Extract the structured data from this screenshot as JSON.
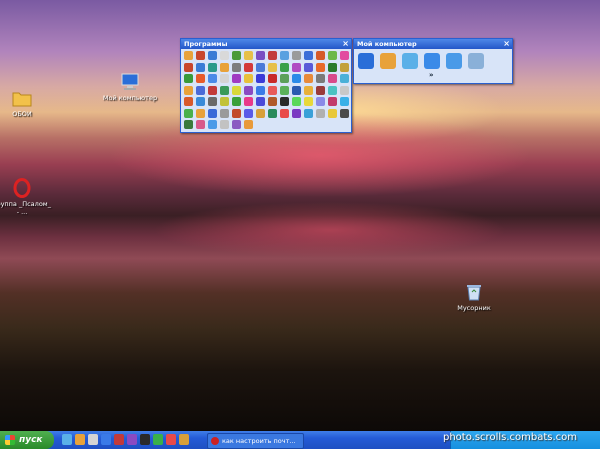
{
  "desktop": {
    "icons": [
      {
        "label": "ОБОИ",
        "icon": "folder-icon"
      },
      {
        "label": "Мой компьютер",
        "icon": "my-computer-icon"
      },
      {
        "label": "группа _Псалом_ - ...",
        "icon": "opera-icon"
      },
      {
        "label": "Мусорник",
        "icon": "recycle-bin-icon"
      }
    ]
  },
  "programs_toolbar": {
    "title": "Программы",
    "close": "×",
    "icon_colors": [
      "#e8a23a",
      "#c8462c",
      "#3a7bd5",
      "#d9d9d9",
      "#4a9a3a",
      "#e6c04a",
      "#7a4fc2",
      "#c23b3b",
      "#5aa0e0",
      "#9a9a9a",
      "#3c6ed8",
      "#d55a2a",
      "#6cb84a",
      "#e24aa0",
      "#c8462c",
      "#3a7bd5",
      "#2a9a8a",
      "#e8a23a",
      "#7d7d7d",
      "#d43a3a",
      "#4a7ad8",
      "#e6c04a",
      "#3aa04a",
      "#b04ac2",
      "#5a5ad8",
      "#e86a2a",
      "#2a7a2a",
      "#c2a03a",
      "#3a9a3a",
      "#e85a2a",
      "#4a8ae8",
      "#d4d4d4",
      "#a03ac2",
      "#e8c03a",
      "#3a3ad8",
      "#c82a2a",
      "#5aa05a",
      "#2a8ae8",
      "#e88a3a",
      "#7a7a7a",
      "#d84a8a",
      "#4ab0d8",
      "#e8a23a",
      "#4a6ad8",
      "#c23a3a",
      "#3a9a5a",
      "#d8d83a",
      "#8a4ac2",
      "#3a7ae8",
      "#e85a5a",
      "#5ab05a",
      "#2a5ab0",
      "#e8b03a",
      "#9a3a3a",
      "#4ac2c2",
      "#c8c8c8",
      "#d85a2a",
      "#3a8ad8",
      "#6a6a6a",
      "#c2c23a",
      "#3aa03a",
      "#e83a8a",
      "#4a4ad8",
      "#b05a2a",
      "#2a2a2a",
      "#5ad85a",
      "#e8d83a",
      "#8a8ae8",
      "#c23a6a",
      "#3ab0e8",
      "#4ab04a",
      "#e8a23a",
      "#3a6ad8",
      "#9a9a9a",
      "#c24a2a",
      "#5a5ae8",
      "#d8a03a",
      "#2a8a5a",
      "#e84a4a",
      "#7a3ac2",
      "#3aa0d8",
      "#b0b0b0",
      "#e8c83a",
      "#4a4a4a",
      "#3a7a3a",
      "#d85a8a",
      "#4a9ae8",
      "#c2c2c2",
      "#8a5ac2",
      "#e89a3a"
    ]
  },
  "my_computer_toolbar": {
    "title": "Мой компьютер",
    "close": "×",
    "icons": [
      {
        "name": "floppy-icon",
        "color": "#2a6ed8"
      },
      {
        "name": "windows-logo-icon",
        "color": "#e8a23a"
      },
      {
        "name": "network-icon",
        "color": "#5ab0e8"
      },
      {
        "name": "control-panel-icon",
        "color": "#3a8ae8"
      },
      {
        "name": "cd-drive-icon",
        "color": "#4a9ae8"
      },
      {
        "name": "drive-icon",
        "color": "#8ab0d8"
      }
    ],
    "more": "»"
  },
  "taskbar": {
    "start_label": "пуск",
    "quick_launch_colors": [
      "#5ab0e8",
      "#e8a23a",
      "#d4d4d4",
      "#3a7ae8",
      "#c23a3a",
      "#8a4ac2",
      "#2a2a2a",
      "#3ab04a",
      "#e84a4a",
      "#d8a03a"
    ],
    "task_label": "как настроить почт..."
  },
  "watermark": "photo.scrolls.combats.com"
}
